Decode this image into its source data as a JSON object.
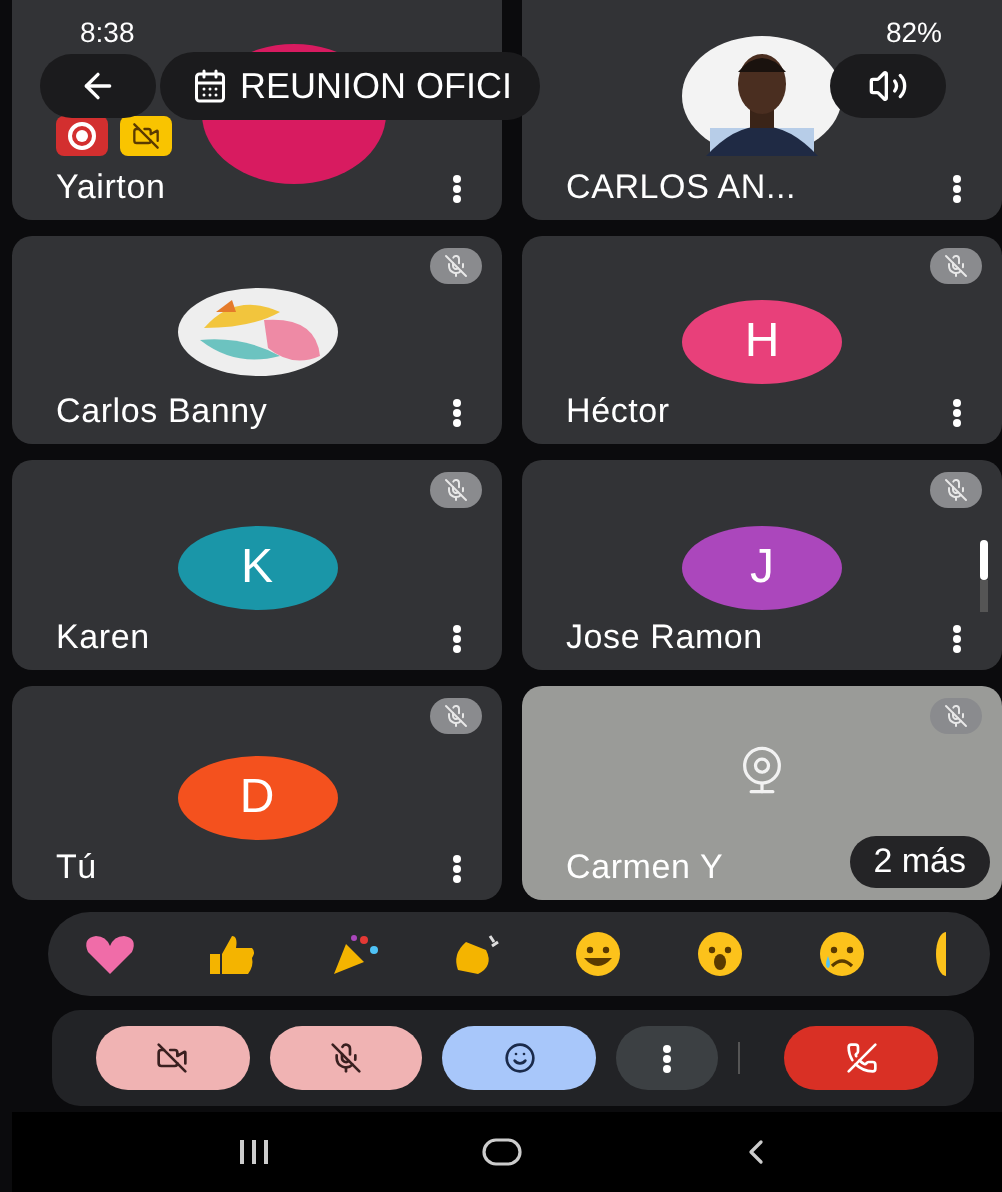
{
  "status_bar": {
    "time": "8:38",
    "battery": "82%"
  },
  "top_bar": {
    "title": "REUNION OFICI"
  },
  "participant_rows": [
    {
      "tiles": [
        {
          "name": "Yairton",
          "kind": "initial",
          "color": "#d81b60",
          "muted": false,
          "recording": true
        },
        {
          "name": "CARLOS AN...",
          "muted": false,
          "recording": false
        }
      ]
    },
    {
      "tiles": [
        {
          "name": "Carlos Banny",
          "kind": "photo_art",
          "muted": true,
          "recording": false
        },
        {
          "name": "Héctor",
          "kind": "initial",
          "initial": "H",
          "color": "#e8407a",
          "muted": true,
          "recording": false
        }
      ]
    },
    {
      "tiles": [
        {
          "name": "Karen",
          "kind": "initial",
          "initial": "K",
          "color": "#1a96a8",
          "muted": true,
          "recording": false
        },
        {
          "name": "Jose Ramon",
          "kind": "initial",
          "initial": "J",
          "color": "#ab47bc",
          "muted": true,
          "recording": false
        }
      ]
    },
    {
      "tiles": [
        {
          "name": "Tú",
          "kind": "initial",
          "initial": "D",
          "color": "#f4511e",
          "muted": true,
          "recording": false
        },
        {
          "name": "Carmen Y",
          "kind": "camera",
          "muted": true,
          "recording": false,
          "more": "2 más"
        }
      ]
    }
  ],
  "controls": [
    {
      "kind": "camera",
      "on": false
    },
    {
      "kind": "mic",
      "on": false
    },
    {
      "kind": "reactions",
      "on": true
    },
    {
      "kind": "more",
      "on": false
    },
    {
      "kind": "hangup"
    }
  ]
}
